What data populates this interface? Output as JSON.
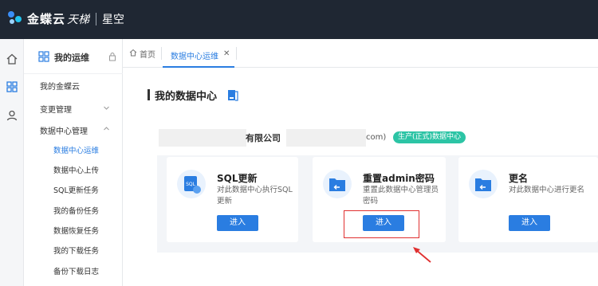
{
  "header": {
    "brand": "金蝶云",
    "brand_sub": "天梯",
    "product": "星空"
  },
  "rail": {
    "icons": [
      "home-icon",
      "apps-grid-icon",
      "user-icon"
    ]
  },
  "sidebar": {
    "title": "我的运维",
    "items": [
      {
        "label": "我的金蝶云"
      },
      {
        "label": "变更管理"
      },
      {
        "label": "数据中心管理"
      }
    ],
    "subitems": [
      {
        "label": "数据中心运维"
      },
      {
        "label": "数据中心上传"
      },
      {
        "label": "SQL更新任务"
      },
      {
        "label": "我的备份任务"
      },
      {
        "label": "数据恢复任务"
      },
      {
        "label": "我的下载任务"
      },
      {
        "label": "备份下载日志"
      }
    ]
  },
  "tabs": {
    "home": "首页",
    "active": "数据中心运维",
    "close": "✕"
  },
  "main": {
    "title": "我的数据中心",
    "company_suffix": "有限公司",
    "domain_tail": "com)",
    "env_badge": "生产(正式)数据中心",
    "cards": [
      {
        "title": "SQL更新",
        "desc": "对此数据中心执行SQL更新",
        "button": "进入"
      },
      {
        "title": "重置admin密码",
        "desc": "重置此数据中心管理员密码",
        "button": "进入"
      },
      {
        "title": "更名",
        "desc": "对此数据中心进行更名",
        "button": "进入"
      }
    ]
  },
  "colors": {
    "accent": "#2a7de1",
    "topbar": "#1f2733",
    "badge": "#2cc4a5",
    "annotation": "#e03030"
  }
}
